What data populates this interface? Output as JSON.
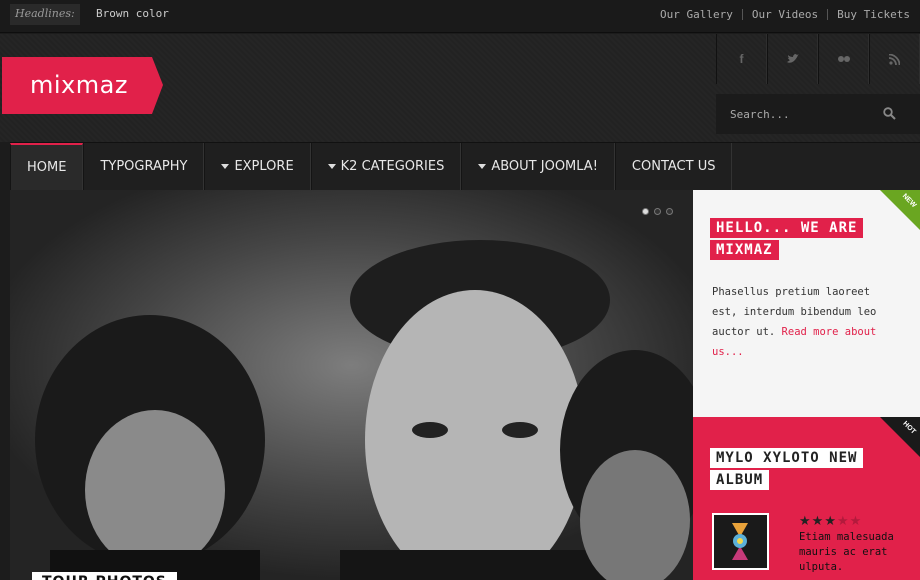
{
  "topbar": {
    "headlines_label": "Headlines:",
    "headline": "Brown color",
    "links": [
      "Our Gallery",
      "Our Videos",
      "Buy Tickets"
    ]
  },
  "header": {
    "logo": "mixmaz",
    "social_icons": [
      "facebook-icon",
      "twitter-icon",
      "flickr-icon",
      "rss-icon"
    ],
    "social_glyphs": [
      "f",
      "🐦",
      "●●",
      "⌁"
    ],
    "search_placeholder": "Search..."
  },
  "nav": {
    "items": [
      {
        "label": "HOME",
        "active": true,
        "dropdown": false
      },
      {
        "label": "TYPOGRAPHY",
        "active": false,
        "dropdown": false
      },
      {
        "label": "EXPLORE",
        "active": false,
        "dropdown": true
      },
      {
        "label": "K2 CATEGORIES",
        "active": false,
        "dropdown": true
      },
      {
        "label": "ABOUT JOOMLA!",
        "active": false,
        "dropdown": true
      },
      {
        "label": "CONTACT US",
        "active": false,
        "dropdown": false
      }
    ]
  },
  "slider": {
    "caption": "TOUR PHOTOS",
    "active_dot": 1,
    "dot_count": 3
  },
  "intro": {
    "ribbon": "NEW",
    "title": "HELLO... WE ARE MIXMAZ",
    "text": "Phasellus pretium laoreet est, interdum bibendum leo auctor ut.",
    "link": "Read more about us..."
  },
  "album": {
    "ribbon": "HOT",
    "title": "MYLO XYLOTO NEW ALBUM",
    "rating": 3,
    "rating_max": 5,
    "text": "Etiam malesuada mauris ac erat ulputa."
  },
  "colors": {
    "accent": "#e1214a",
    "ribbon_new": "#6aa621",
    "ribbon_hot": "#1a1a1a"
  }
}
